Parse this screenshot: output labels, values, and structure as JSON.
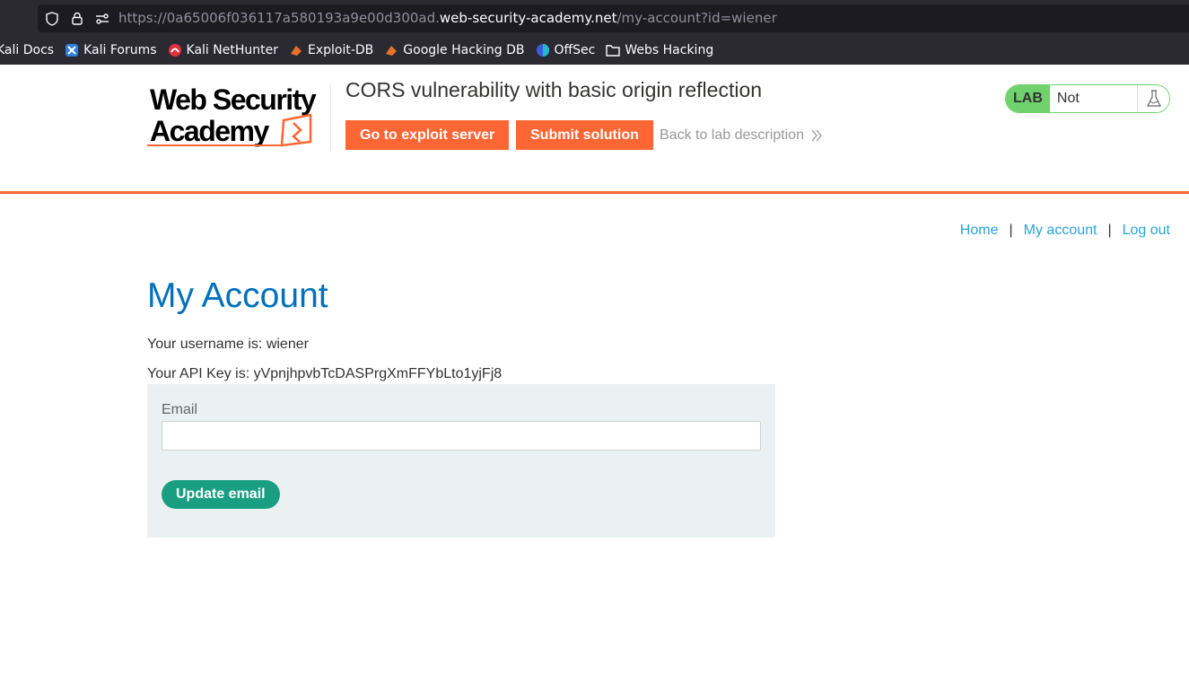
{
  "browser": {
    "url_prefix": "https://0a65006f036117a580193a9e00d300ad.",
    "url_host": "web-security-academy.net",
    "url_path": "/my-account?id=wiener",
    "bookmarks": [
      {
        "label": "Kali Docs",
        "icon": "kali-docs-icon"
      },
      {
        "label": "Kali Forums",
        "icon": "kali-forums-icon"
      },
      {
        "label": "Kali NetHunter",
        "icon": "kali-nethunter-icon"
      },
      {
        "label": "Exploit-DB",
        "icon": "exploit-db-icon"
      },
      {
        "label": "Google Hacking DB",
        "icon": "google-hacking-db-icon"
      },
      {
        "label": "OffSec",
        "icon": "offsec-icon"
      },
      {
        "label": "Webs Hacking",
        "icon": "folder-icon"
      }
    ]
  },
  "header": {
    "logo_line1": "Web Security",
    "logo_line2": "Academy",
    "lab_title": "CORS vulnerability with basic origin reflection",
    "exploit_button": "Go to exploit server",
    "submit_button": "Submit solution",
    "back_link": "Back to lab description",
    "lab_badge": "LAB",
    "lab_state": "Not solved"
  },
  "nav": {
    "home": "Home",
    "sep": "|",
    "my_account": "My account",
    "log_out": "Log out"
  },
  "main": {
    "title": "My Account",
    "username_text": "Your username is: wiener",
    "api_key_text": "Your API Key is: yVpnjhpvbTcDASPrgXmFFYbLto1yjFj8",
    "email_label": "Email",
    "email_value": "",
    "update_button": "Update email"
  },
  "colors": {
    "accent_orange": "#ff6633",
    "title_blue": "#0071bc",
    "link_blue": "#29a3d9",
    "button_green": "#1a9e81",
    "lab_green": "#70d16d"
  }
}
